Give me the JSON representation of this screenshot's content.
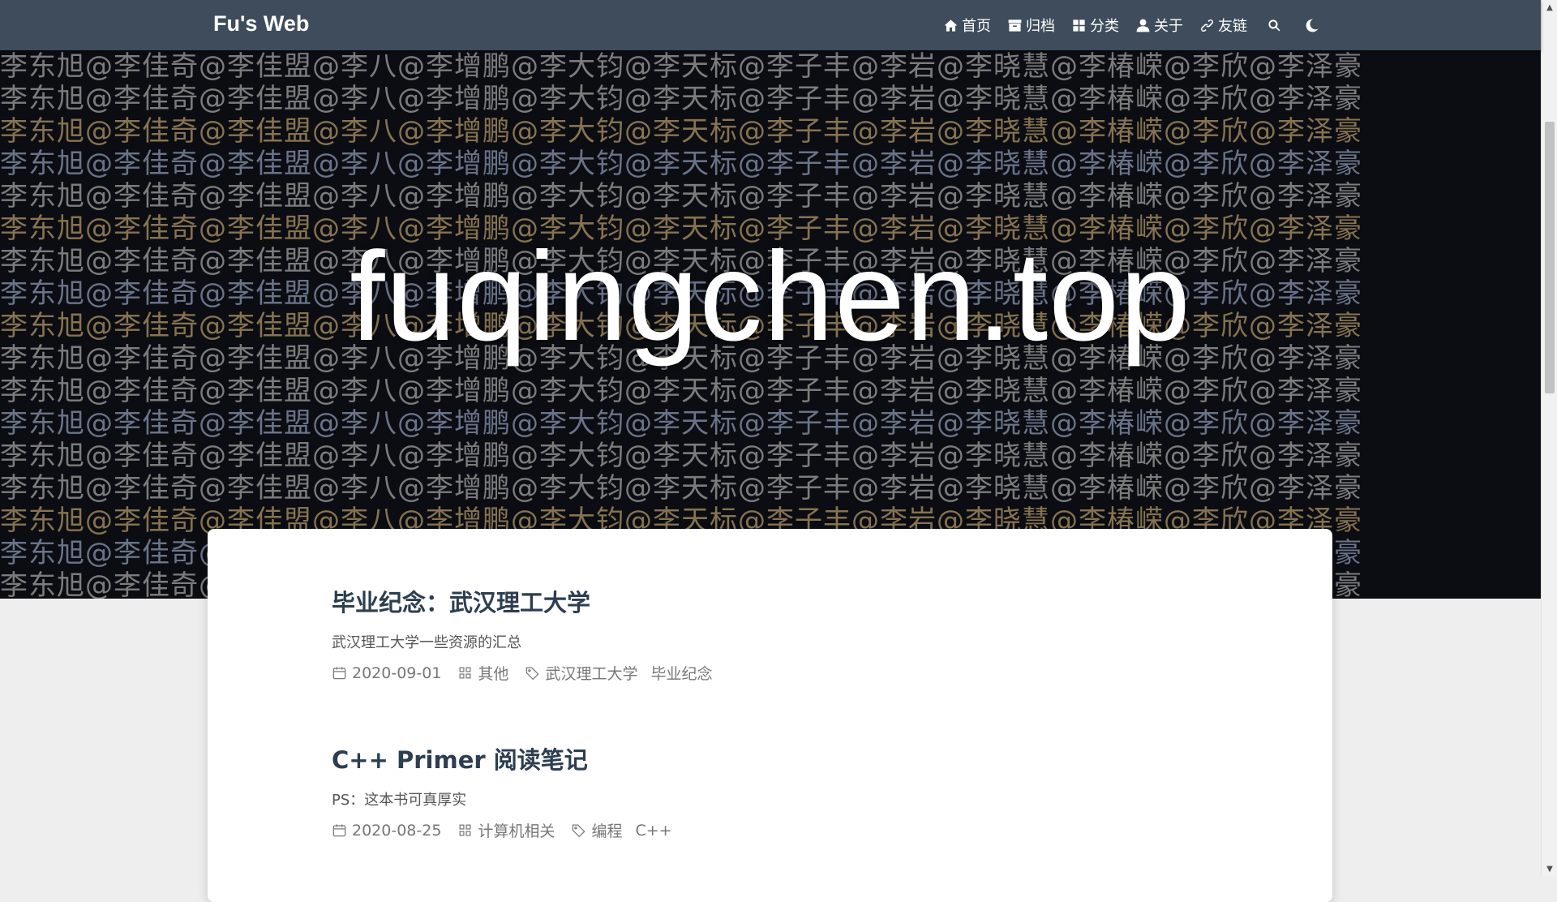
{
  "navbar": {
    "brand": "Fu's Web",
    "items": [
      {
        "label": "首页",
        "icon": "home-icon"
      },
      {
        "label": "归档",
        "icon": "archive-icon"
      },
      {
        "label": "分类",
        "icon": "category-icon"
      },
      {
        "label": "关于",
        "icon": "user-icon"
      },
      {
        "label": "友链",
        "icon": "link-icon"
      }
    ],
    "search_icon": "search-icon",
    "theme_icon": "moon-icon"
  },
  "banner": {
    "title": "fuqingchen.top",
    "background_text": "李东旭@李佳奇@李佳盟@李八@李增鹏@李大钧@李天标@李子丰@李岩@李晓慧@李椿嵘@李欣@李泽豪"
  },
  "posts": [
    {
      "title": "毕业纪念：武汉理工大学",
      "excerpt": "武汉理工大学一些资源的汇总",
      "date": "2020-09-01",
      "category": "其他",
      "tags": [
        "武汉理工大学",
        "毕业纪念"
      ]
    },
    {
      "title": "C++ Primer 阅读笔记",
      "excerpt": "PS：这本书可真厚实",
      "date": "2020-08-25",
      "category": "计算机相关",
      "tags": [
        "编程",
        "C++"
      ]
    }
  ],
  "colors": {
    "navbar": "#3e4c5c",
    "title": "#2c3e50",
    "page_bg": "#eeeeee"
  }
}
